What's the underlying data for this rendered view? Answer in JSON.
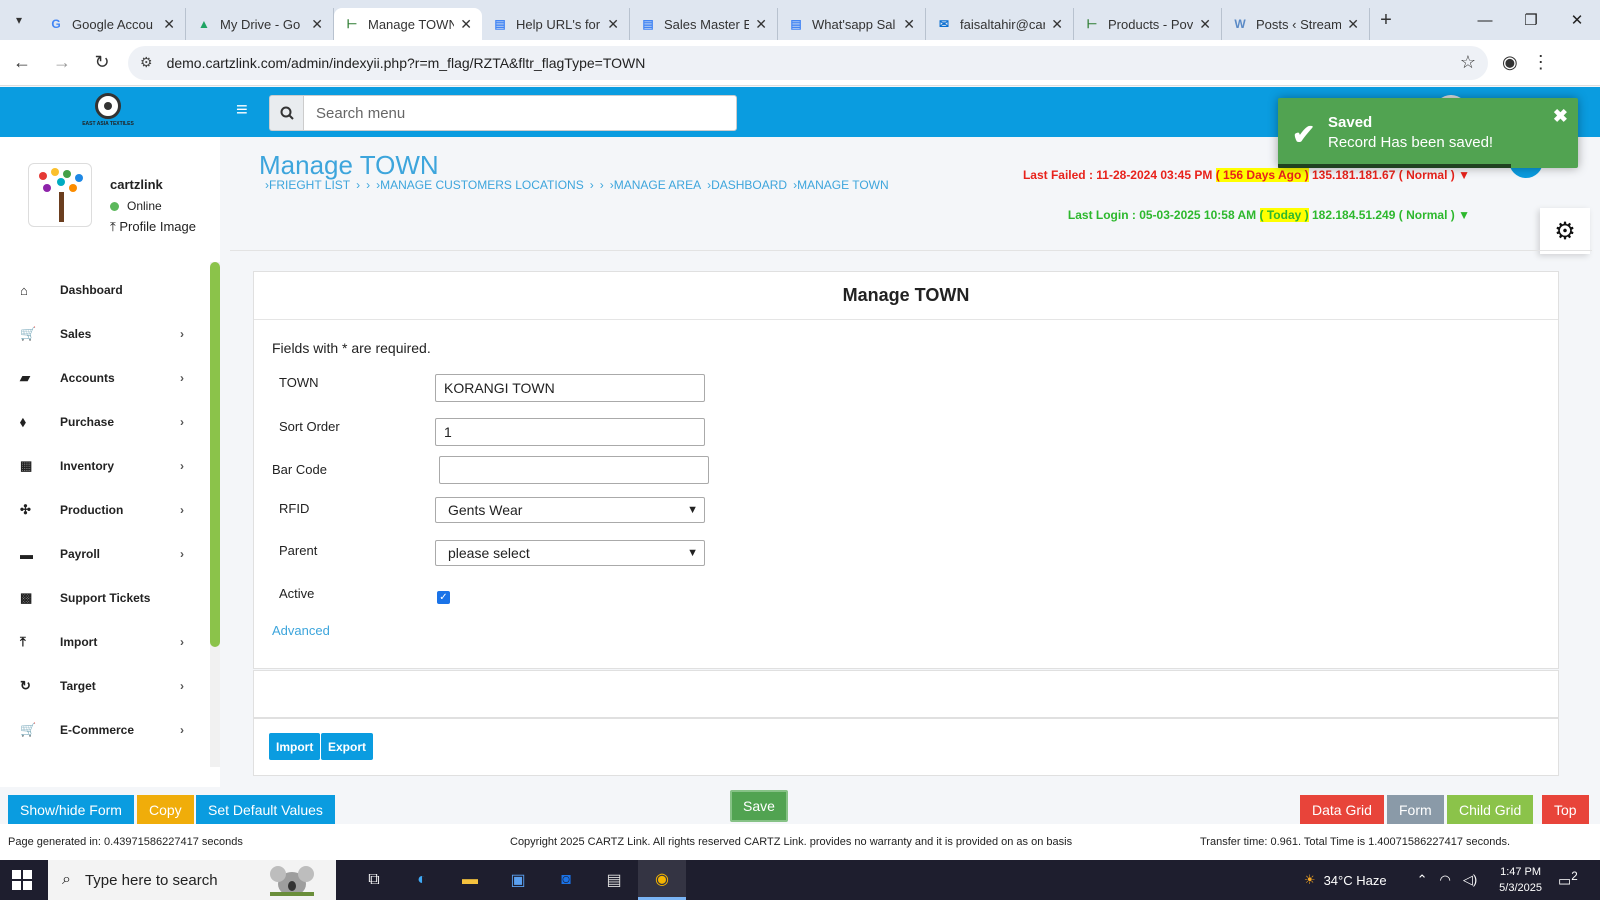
{
  "browser": {
    "tabs": [
      {
        "title": "Google Accou",
        "icon": "google-g-icon",
        "color": "#4285f4"
      },
      {
        "title": "My Drive - Go",
        "icon": "drive-icon",
        "color": "#1fa463"
      },
      {
        "title": "Manage TOWN",
        "icon": "cartzlink-icon",
        "color": "#2e7d32",
        "active": true
      },
      {
        "title": "Help URL's for",
        "icon": "docs-icon",
        "color": "#4285f4"
      },
      {
        "title": "Sales Master E",
        "icon": "docs-icon",
        "color": "#4285f4"
      },
      {
        "title": "What'sapp Sal",
        "icon": "docs-icon",
        "color": "#4285f4"
      },
      {
        "title": "faisaltahir@car",
        "icon": "mail-icon",
        "color": "#0a6fd1"
      },
      {
        "title": "Products - Pov",
        "icon": "cartzlink-icon",
        "color": "#2e7d32"
      },
      {
        "title": "Posts ‹ Stream",
        "icon": "wordpress-icon",
        "color": "#5a8ac6"
      }
    ],
    "url": "demo.cartzlink.com/admin/indexyii.php?r=m_flag/RZTA&fltr_flagType=TOWN"
  },
  "header": {
    "search_placeholder": "Search menu"
  },
  "toast": {
    "title": "Saved",
    "message": "Record Has been saved!"
  },
  "profile": {
    "name": "cartzlink",
    "status": "Online",
    "upload_label": "Profile Image"
  },
  "menu": [
    {
      "label": "Dashboard",
      "icon": "home-icon",
      "has_children": false
    },
    {
      "label": "Sales",
      "icon": "cart-icon",
      "has_children": true
    },
    {
      "label": "Accounts",
      "icon": "briefcase-icon",
      "has_children": true
    },
    {
      "label": "Purchase",
      "icon": "tags-icon",
      "has_children": true
    },
    {
      "label": "Inventory",
      "icon": "grid-icon",
      "has_children": true
    },
    {
      "label": "Production",
      "icon": "production-icon",
      "has_children": true
    },
    {
      "label": "Payroll",
      "icon": "money-icon",
      "has_children": true
    },
    {
      "label": "Support Tickets",
      "icon": "ticket-icon",
      "has_children": false
    },
    {
      "label": "Import",
      "icon": "upload-icon",
      "has_children": true
    },
    {
      "label": "Target",
      "icon": "refresh-icon",
      "has_children": true
    },
    {
      "label": "E-Commerce",
      "icon": "cart-icon",
      "has_children": true
    }
  ],
  "page": {
    "title": "Manage TOWN",
    "breadcrumbs": [
      "›FRIEGHT LIST",
      "›",
      "›",
      "›MANAGE CUSTOMERS LOCATIONS",
      "›",
      "›",
      "›MANAGE AREA",
      "›DASHBOARD",
      "›MANAGE TOWN"
    ],
    "last_failed": {
      "prefix": "Last Failed : 11-28-2024 03:45 PM",
      "ago": "( 156 Days Ago )",
      "ip": "135.181.181.67",
      "status": "( Normal )",
      "arrow": "▼"
    },
    "last_login": {
      "prefix": "Last Login : 05-03-2025 10:58 AM",
      "ago": "( Today )",
      "ip": "182.184.51.249",
      "status": "( Normal )",
      "arrow": "▼"
    }
  },
  "form": {
    "heading": "Manage TOWN",
    "required_note": "Fields with * are required.",
    "town_label": "TOWN",
    "town_value": "KORANGI TOWN",
    "sort_label": "Sort Order",
    "sort_value": "1",
    "barcode_label": "Bar Code",
    "barcode_value": "",
    "rfid_label": "RFID",
    "rfid_value": "Gents Wear",
    "parent_label": "Parent",
    "parent_value": "please select",
    "active_label": "Active",
    "active_checked": true,
    "advanced_link": "Advanced"
  },
  "actions": {
    "import": "Import",
    "export": "Export",
    "show_hide": "Show/hide Form",
    "copy": "Copy",
    "set_default": "Set Default Values",
    "save": "Save",
    "data_grid": "Data Grid",
    "form": "Form",
    "child_grid": "Child Grid",
    "top": "Top"
  },
  "footer": {
    "generated": "Page generated in: 0.43971586227417 seconds",
    "copyright": "Copyright 2025 CARTZ Link. All rights reserved CARTZ Link. provides no warranty and it is provided on as on basis",
    "transfer": "Transfer time: 0.961. Total Time is 1.40071586227417 seconds."
  },
  "taskbar": {
    "search_placeholder": "Type here to search",
    "weather": "34°C  Haze",
    "time": "1:47 PM",
    "date": "5/3/2025",
    "notifications": "2"
  },
  "colors": {
    "brand_blue": "#0a9ce0",
    "success_green": "#51a351",
    "copy_yellow": "#f0ad0a",
    "danger_red": "#e8443a",
    "gray": "#8a9aa8",
    "child_green": "#8bc34a",
    "top_red": "#e8443a"
  }
}
